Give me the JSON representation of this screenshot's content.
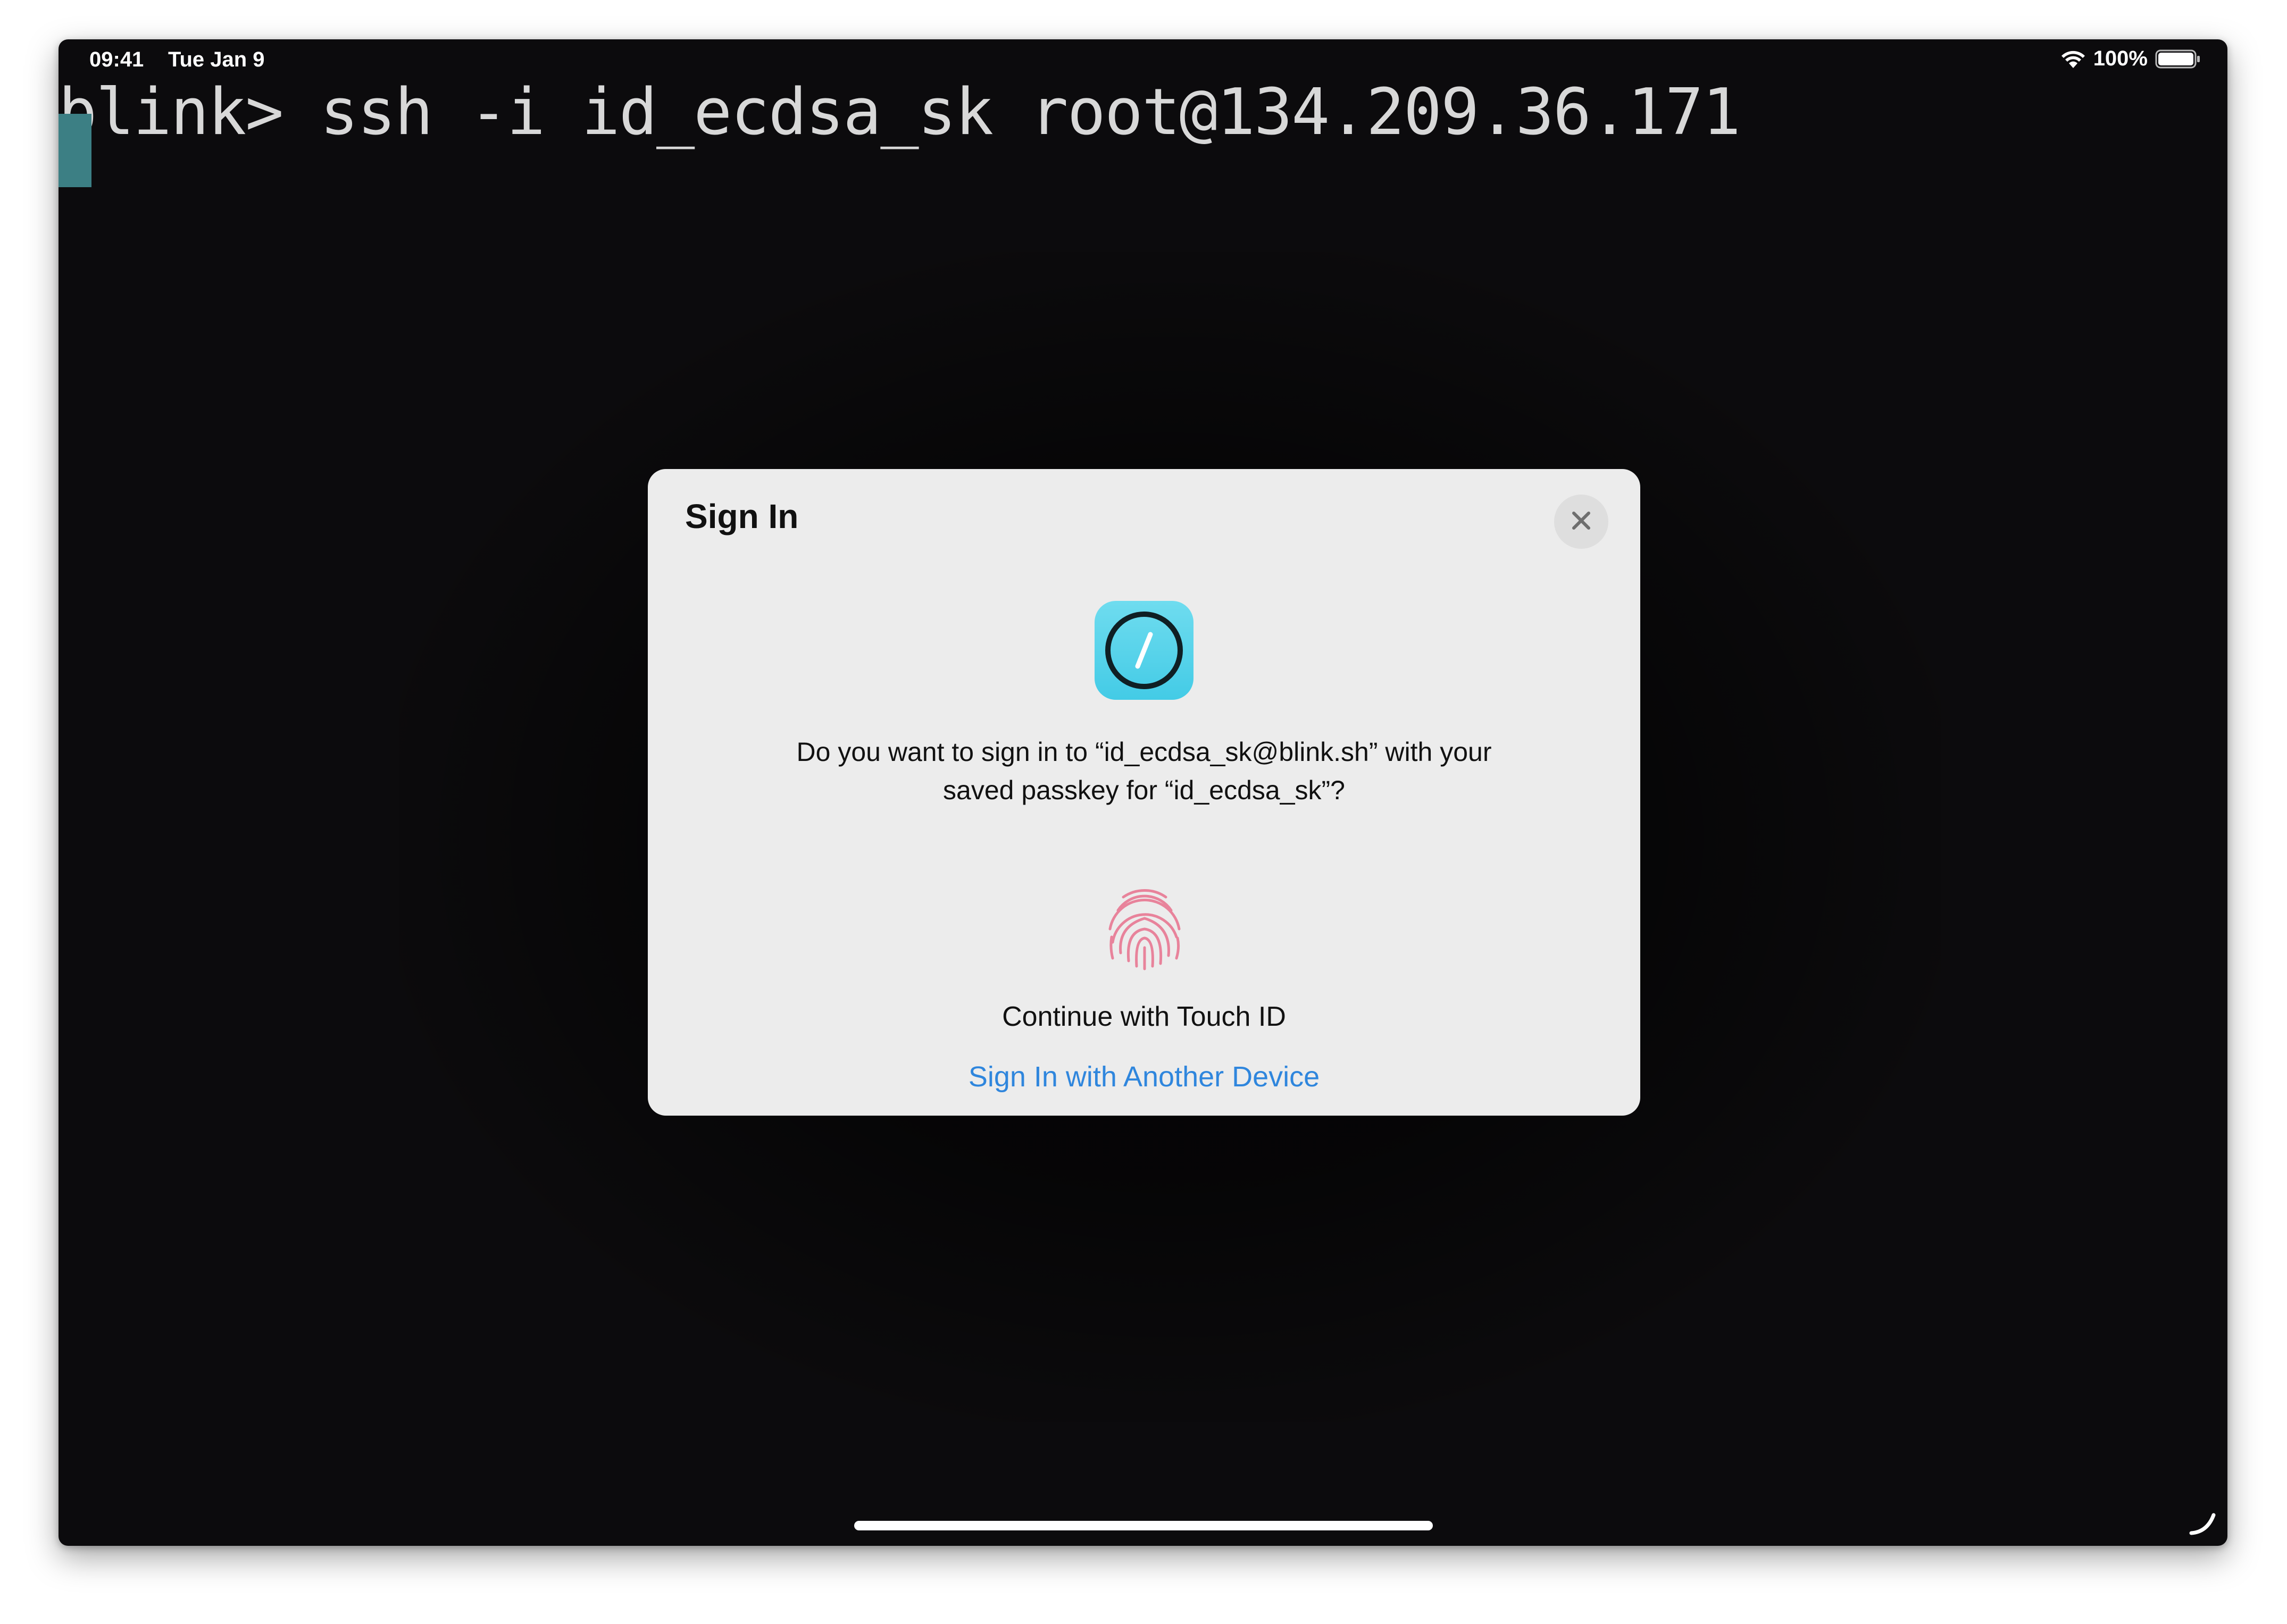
{
  "status_bar": {
    "time": "09:41",
    "date": "Tue Jan 9",
    "battery": "100%",
    "wifi_icon": "wifi-icon",
    "battery_icon": "battery-icon"
  },
  "terminal": {
    "prompt_line": "blink> ssh -i id_ecdsa_sk root@134.209.36.171"
  },
  "dialog": {
    "title": "Sign In",
    "close_icon": "close-icon",
    "app_icon": "blink-app-icon",
    "message_line1": "Do you want to sign in to “id_ecdsa_sk@blink.sh” with your",
    "message_line2": "saved passkey for “id_ecdsa_sk”?",
    "touch_id_icon": "fingerprint-icon",
    "touch_id_label": "Continue with Touch ID",
    "other_device_link": "Sign In with Another Device"
  },
  "colors": {
    "terminal_bg": "#0c0b0d",
    "cursor": "#3c7f84",
    "dialog_bg": "#ececec",
    "link": "#2f86dd",
    "app_icon": "#4fd0e8",
    "fingerprint": "#e8839b"
  }
}
